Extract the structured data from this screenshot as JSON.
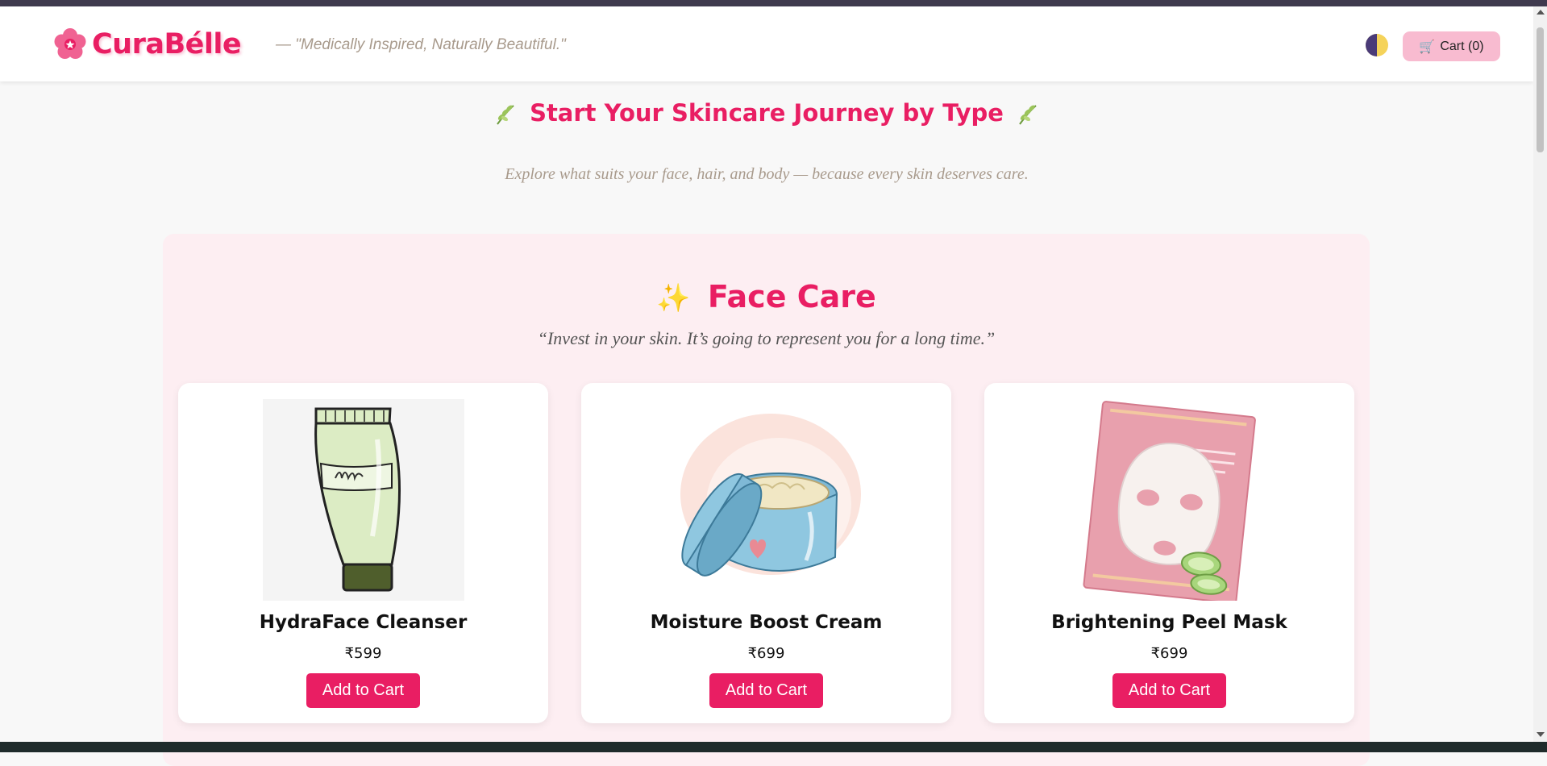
{
  "brand": {
    "name": "CuraBélle",
    "tagline": "— \"Medically Inspired, Naturally Beautiful.\"",
    "color": "#e91e63"
  },
  "header": {
    "theme_toggle_icon": "half-moon-icon",
    "cart_label": "Cart (0)",
    "cart_icon": "shopping-cart-icon"
  },
  "journey": {
    "title": "Start Your Skincare Journey by Type",
    "subtitle": "Explore what suits your face, hair, and body — because every skin deserves care.",
    "leaf_icon": "herb-icon"
  },
  "face_care": {
    "title": "Face Care",
    "title_icon": "sparkles-icon",
    "quote": "“Invest in your skin. It’s going to represent you for a long time.”",
    "products": [
      {
        "name": "HydraFace Cleanser",
        "price": "₹599",
        "button": "Add to Cart",
        "image": "cleanser-tube-illustration"
      },
      {
        "name": "Moisture Boost Cream",
        "price": "₹699",
        "button": "Add to Cart",
        "image": "cream-jar-illustration"
      },
      {
        "name": "Brightening Peel Mask",
        "price": "₹699",
        "button": "Add to Cart",
        "image": "sheet-mask-illustration"
      }
    ]
  },
  "colors": {
    "accent": "#e91e63",
    "section_bg": "#fdeef2",
    "cart_bg": "#f8bbd0",
    "page_bg": "#f8f8f8"
  }
}
